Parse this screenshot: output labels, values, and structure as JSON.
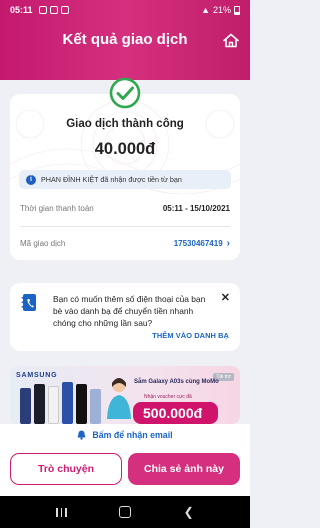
{
  "status_bar": {
    "time": "05:11",
    "battery": "21%"
  },
  "header": {
    "title": "Kết quả giao dịch"
  },
  "receipt": {
    "status": "Giao dịch thành công",
    "amount": "40.000đ",
    "recipient_note": "PHAN ĐÌNH KIỆT đã nhận được tiền từ bạn",
    "time_label": "Thời gian thanh toán",
    "time_value": "05:11 - 15/10/2021",
    "txn_label": "Mã giao dịch",
    "txn_value": "17530467419"
  },
  "contact_prompt": {
    "text": "Bạn có muốn thêm số điện thoại của bạn bè vào danh bạ để chuyển tiền nhanh chóng cho những lần sau?",
    "action": "THÊM VÀO DANH BẠ"
  },
  "ad_banner": {
    "brand": "SAMSUNG",
    "sponsored": "Tài trợ",
    "headline": "Sắm Galaxy A03s cùng MoMo",
    "subline": "Nhận voucher cực đã",
    "amount": "500.000đ"
  },
  "actions": {
    "email_link": "Bấm để nhận email",
    "chat_button": "Trò chuyện",
    "share_button": "Chia sẻ ảnh này"
  },
  "colors": {
    "brand": "#d4307f",
    "link": "#1c64c4",
    "success": "#2fa84f"
  }
}
